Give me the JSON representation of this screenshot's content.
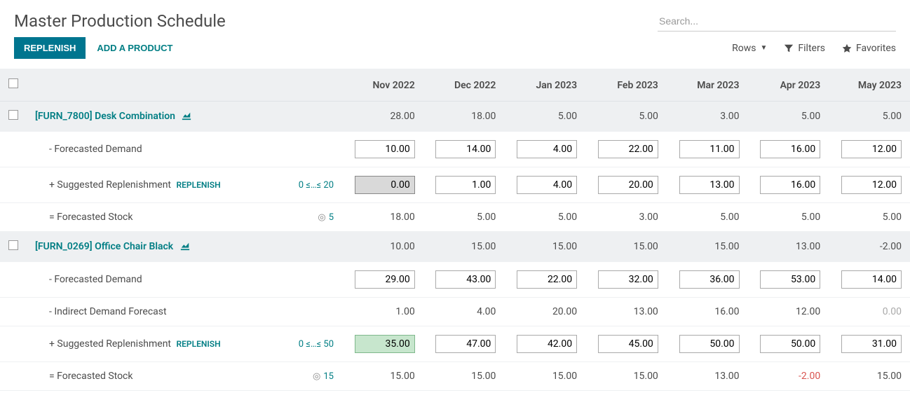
{
  "header": {
    "title": "Master Production Schedule",
    "search_placeholder": "Search..."
  },
  "toolbar": {
    "replenish_label": "REPLENISH",
    "add_product_label": "ADD A PRODUCT",
    "rows_label": "Rows",
    "filters_label": "Filters",
    "favorites_label": "Favorites"
  },
  "columns": [
    "Nov 2022",
    "Dec 2022",
    "Jan 2023",
    "Feb 2023",
    "Mar 2023",
    "Apr 2023",
    "May 2023"
  ],
  "labels": {
    "forecasted_demand": "- Forecasted Demand",
    "indirect_demand": "- Indirect Demand Forecast",
    "suggested_replenishment": "+ Suggested Replenishment",
    "replenish_inline": "REPLENISH",
    "forecasted_stock": "= Forecasted Stock"
  },
  "products": [
    {
      "name": "[FURN_7800] Desk Combination",
      "summary": [
        "28.00",
        "18.00",
        "5.00",
        "5.00",
        "3.00",
        "5.00",
        "5.00"
      ],
      "forecasted_demand": [
        "10.00",
        "14.00",
        "4.00",
        "22.00",
        "11.00",
        "16.00",
        "12.00"
      ],
      "replenish_hint": "0 ≤…≤ 20",
      "suggested_replenishment": [
        "0.00",
        "1.00",
        "4.00",
        "20.00",
        "13.00",
        "16.00",
        "12.00"
      ],
      "replenishment_style": [
        "grey",
        "",
        "",
        "",
        "",
        "",
        ""
      ],
      "stock_target": "5",
      "forecasted_stock": [
        "18.00",
        "5.00",
        "5.00",
        "3.00",
        "5.00",
        "5.00",
        "5.00"
      ]
    },
    {
      "name": "[FURN_0269] Office Chair Black",
      "summary": [
        "10.00",
        "15.00",
        "15.00",
        "15.00",
        "15.00",
        "13.00",
        "-2.00"
      ],
      "forecasted_demand": [
        "29.00",
        "43.00",
        "22.00",
        "32.00",
        "36.00",
        "53.00",
        "14.00"
      ],
      "indirect_demand": [
        "1.00",
        "4.00",
        "20.00",
        "13.00",
        "16.00",
        "12.00",
        "0.00"
      ],
      "indirect_demand_muted": [
        false,
        false,
        false,
        false,
        false,
        false,
        true
      ],
      "replenish_hint": "0 ≤…≤ 50",
      "suggested_replenishment": [
        "35.00",
        "47.00",
        "42.00",
        "45.00",
        "50.00",
        "50.00",
        "31.00"
      ],
      "replenishment_style": [
        "green",
        "",
        "",
        "",
        "",
        "",
        ""
      ],
      "stock_target": "15",
      "forecasted_stock": [
        "15.00",
        "15.00",
        "15.00",
        "15.00",
        "13.00",
        "-2.00",
        "15.00"
      ],
      "stock_negative": [
        false,
        false,
        false,
        false,
        false,
        true,
        false
      ]
    }
  ]
}
